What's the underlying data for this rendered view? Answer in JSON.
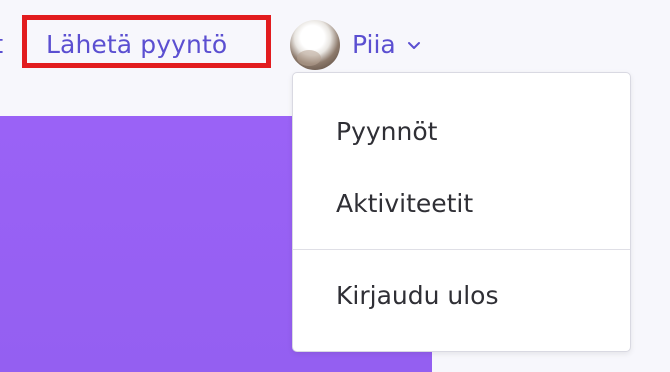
{
  "header": {
    "cut_link_label": "t",
    "send_request_label": "Lähetä pyyntö"
  },
  "user_menu": {
    "name": "Piia",
    "avatar_icon": "user-avatar",
    "chevron_icon": "chevron-down-icon"
  },
  "dropdown": {
    "items": [
      {
        "label": "Pyynnöt"
      },
      {
        "label": "Aktiviteetit"
      },
      {
        "label": "Kirjaudu ulos"
      }
    ]
  },
  "colors": {
    "accent": "#5b4fd1",
    "hero": "#9a62f6",
    "highlight": "#e21c1f",
    "menu_text": "#2f2f35"
  }
}
